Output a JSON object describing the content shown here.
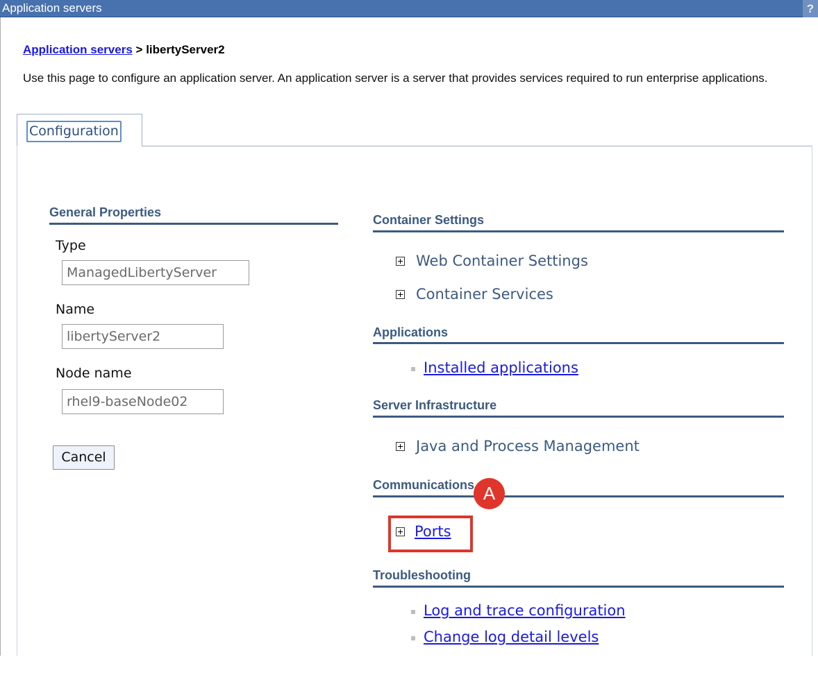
{
  "window": {
    "title": "Application servers",
    "help_label": "?"
  },
  "breadcrumb": {
    "parent_link": "Application servers",
    "separator": ">",
    "current": "libertyServer2"
  },
  "description": "Use this page to configure an application server. An application server is a server that provides services required to run enterprise applications.",
  "tabs": [
    {
      "label": "Configuration",
      "selected": true
    }
  ],
  "general_properties": {
    "heading": "General Properties",
    "fields": [
      {
        "label": "Type",
        "value": "ManagedLibertyServer"
      },
      {
        "label": "Name",
        "value": "libertyServer2"
      },
      {
        "label": "Node name",
        "value": "rhel9-baseNode02"
      }
    ],
    "cancel_label": "Cancel"
  },
  "sections": {
    "container_settings": {
      "heading": "Container Settings",
      "items": [
        "Web Container Settings",
        "Container Services"
      ]
    },
    "applications": {
      "heading": "Applications",
      "items": [
        "Installed applications"
      ]
    },
    "server_infrastructure": {
      "heading": "Server Infrastructure",
      "items": [
        "Java and Process Management"
      ]
    },
    "communications": {
      "heading": "Communications",
      "items": [
        "Ports"
      ]
    },
    "troubleshooting": {
      "heading": "Troubleshooting",
      "items": [
        "Log and trace configuration",
        "Change log detail levels"
      ]
    }
  },
  "annotation": {
    "marker_label": "A",
    "color": "#e0352b"
  },
  "colors": {
    "title_bar": "#4872ae",
    "section_heading": "#3d5a80",
    "link": "#1a1adf"
  }
}
